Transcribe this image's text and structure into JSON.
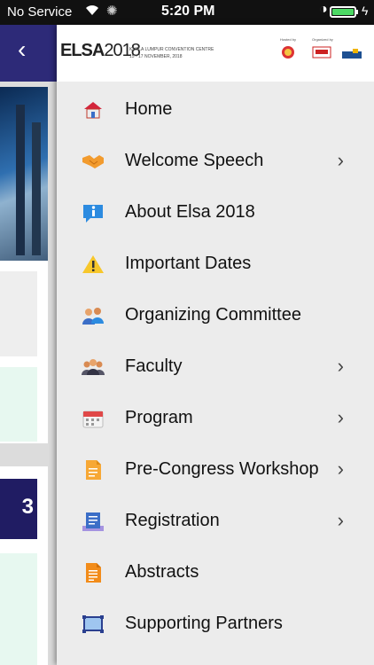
{
  "status_bar": {
    "carrier": "No Service",
    "time": "5:20 PM"
  },
  "banner": {
    "logo_text": "ELSA",
    "logo_year": "2018",
    "venue_line1": "KUALA LUMPUR CONVENTION CENTRE",
    "venue_line2": "15 - 17 NOVEMBER, 2018",
    "hosted_by": "Hosted by",
    "organized_by": "Organized by"
  },
  "menu": {
    "items": [
      {
        "label": "Home",
        "icon": "home-icon",
        "chevron": false
      },
      {
        "label": "Welcome Speech",
        "icon": "handshake-icon",
        "chevron": true
      },
      {
        "label": "About Elsa 2018",
        "icon": "info-icon",
        "chevron": false
      },
      {
        "label": "Important Dates",
        "icon": "warning-icon",
        "chevron": false
      },
      {
        "label": "Organizing Committee",
        "icon": "committee-icon",
        "chevron": false
      },
      {
        "label": "Faculty",
        "icon": "faculty-icon",
        "chevron": true
      },
      {
        "label": "Program",
        "icon": "calendar-icon",
        "chevron": true
      },
      {
        "label": "Pre-Congress Workshop",
        "icon": "document-icon",
        "chevron": true
      },
      {
        "label": "Registration",
        "icon": "registration-icon",
        "chevron": true
      },
      {
        "label": "Abstracts",
        "icon": "abstracts-icon",
        "chevron": false
      },
      {
        "label": "Supporting Partners",
        "icon": "partners-icon",
        "chevron": false
      }
    ]
  },
  "colors": {
    "nav_bar": "#2d2a78",
    "drawer_bg": "#ececec",
    "battery": "#4cd964"
  }
}
